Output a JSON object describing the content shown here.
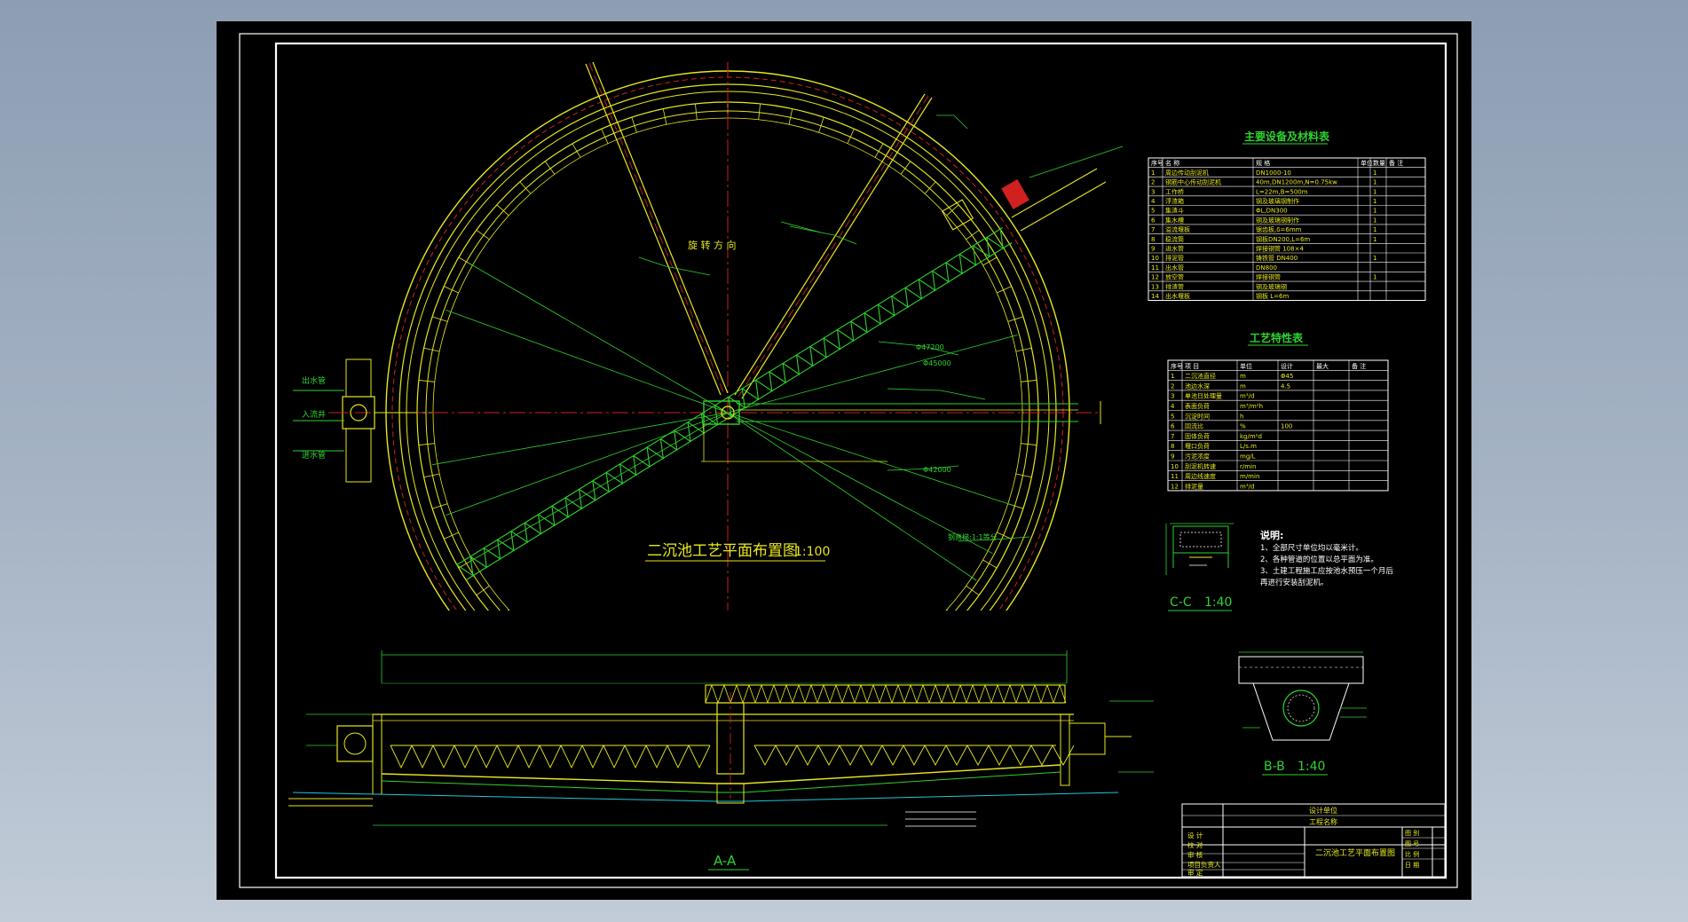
{
  "drawing": {
    "plan_title": "二沉池工艺平面布置图",
    "plan_scale": "1:100",
    "rotation_label": "旋 转 方 向",
    "section_aa_label": "A-A",
    "section_bb_label": "B-B",
    "section_bb_scale": "1:40",
    "section_cc_label": "C-C",
    "section_cc_scale": "1:40",
    "dia_labels": [
      "Φ47200",
      "Φ45000",
      "Φ42000"
    ],
    "left_labels": [
      "出水管",
      "入流井",
      "进水管"
    ],
    "plan_right_note": "钢直梯:1:1等分"
  },
  "equipment_table": {
    "title": "主要设备及材料表",
    "headers": [
      "序号",
      "名 称",
      "规 格",
      "单位",
      "数量",
      "备 注"
    ],
    "rows": [
      [
        "1",
        "周边传动刮泥机",
        "DN1000-10",
        "",
        "1",
        ""
      ],
      [
        "2",
        "钢筋中心传动刮泥机",
        "40m,DN1200m,N=0.75kw",
        "",
        "1",
        ""
      ],
      [
        "3",
        "工作桥",
        "L=22m,B=500m",
        "",
        "1",
        ""
      ],
      [
        "4",
        "浮渣箱",
        "钢及玻璃钢制作",
        "",
        "1",
        ""
      ],
      [
        "5",
        "集渣斗",
        "ΦL,DN300",
        "",
        "1",
        ""
      ],
      [
        "6",
        "集水槽",
        "钢及玻璃钢制作",
        "",
        "1",
        ""
      ],
      [
        "7",
        "溢流堰板",
        "锯齿板,δ=6mm",
        "",
        "1",
        ""
      ],
      [
        "8",
        "稳流筒",
        "钢板DN200,L=6m",
        "",
        "1",
        ""
      ],
      [
        "9",
        "进水管",
        "焊接钢管 108×4",
        "",
        "",
        ""
      ],
      [
        "10",
        "排泥管",
        "铸铁管 DN400",
        "",
        "1",
        ""
      ],
      [
        "11",
        "出水管",
        "DN800",
        "",
        "",
        ""
      ],
      [
        "12",
        "放空管",
        "焊接钢管",
        "",
        "1",
        ""
      ],
      [
        "13",
        "排渣管",
        "钢及玻璃钢",
        "",
        "",
        ""
      ],
      [
        "14",
        "出水堰板",
        "钢板 L=6m",
        "",
        "",
        ""
      ]
    ]
  },
  "process_table": {
    "title": "工艺特性表",
    "headers": [
      "序号",
      "项 目",
      "单位",
      "设计",
      "最大",
      "备 注"
    ],
    "rows": [
      [
        "1",
        "二沉池直径",
        "m",
        "Φ45",
        "",
        ""
      ],
      [
        "2",
        "池边水深",
        "m",
        "4.5",
        "",
        ""
      ],
      [
        "3",
        "单池日处理量",
        "m³/d",
        "",
        "",
        ""
      ],
      [
        "4",
        "表面负荷",
        "m³/m²h",
        "",
        "",
        ""
      ],
      [
        "5",
        "沉淀时间",
        "h",
        "",
        "",
        ""
      ],
      [
        "6",
        "回流比",
        "%",
        "100",
        "",
        ""
      ],
      [
        "7",
        "固体负荷",
        "kg/m²d",
        "",
        "",
        ""
      ],
      [
        "8",
        "堰口负荷",
        "L/s.m",
        "",
        "",
        ""
      ],
      [
        "9",
        "污泥浓度",
        "mg/L",
        "",
        "",
        ""
      ],
      [
        "10",
        "刮泥机转速",
        "r/min",
        "",
        "",
        ""
      ],
      [
        "11",
        "周边线速度",
        "m/min",
        "",
        "",
        ""
      ],
      [
        "12",
        "排泥量",
        "m³/d",
        "",
        "",
        ""
      ]
    ]
  },
  "notes": {
    "title": "说明:",
    "items": [
      "1、全部尺寸单位均以毫米计。",
      "2、各种管道的位置以总平面为准。",
      "3、土建工程施工应按池水预压一个月后",
      "再进行安装刮泥机。"
    ]
  },
  "title_block": {
    "design_unit_label": "设计单位",
    "project_label": "工程名称",
    "drawing_name": "二沉池工艺平面布置图",
    "roles": [
      "设 计",
      "校 对",
      "审 核",
      "项目负责人",
      "审 定"
    ],
    "meta": [
      "图 别",
      "图 号",
      "比 例",
      "日 期"
    ]
  },
  "colors": {
    "background": "#000000",
    "border": "#ffffff",
    "yellow": "#e8e820",
    "green": "#2fd22f",
    "red": "#d02020",
    "cyan": "#22c8d8",
    "white": "#ffffff"
  }
}
